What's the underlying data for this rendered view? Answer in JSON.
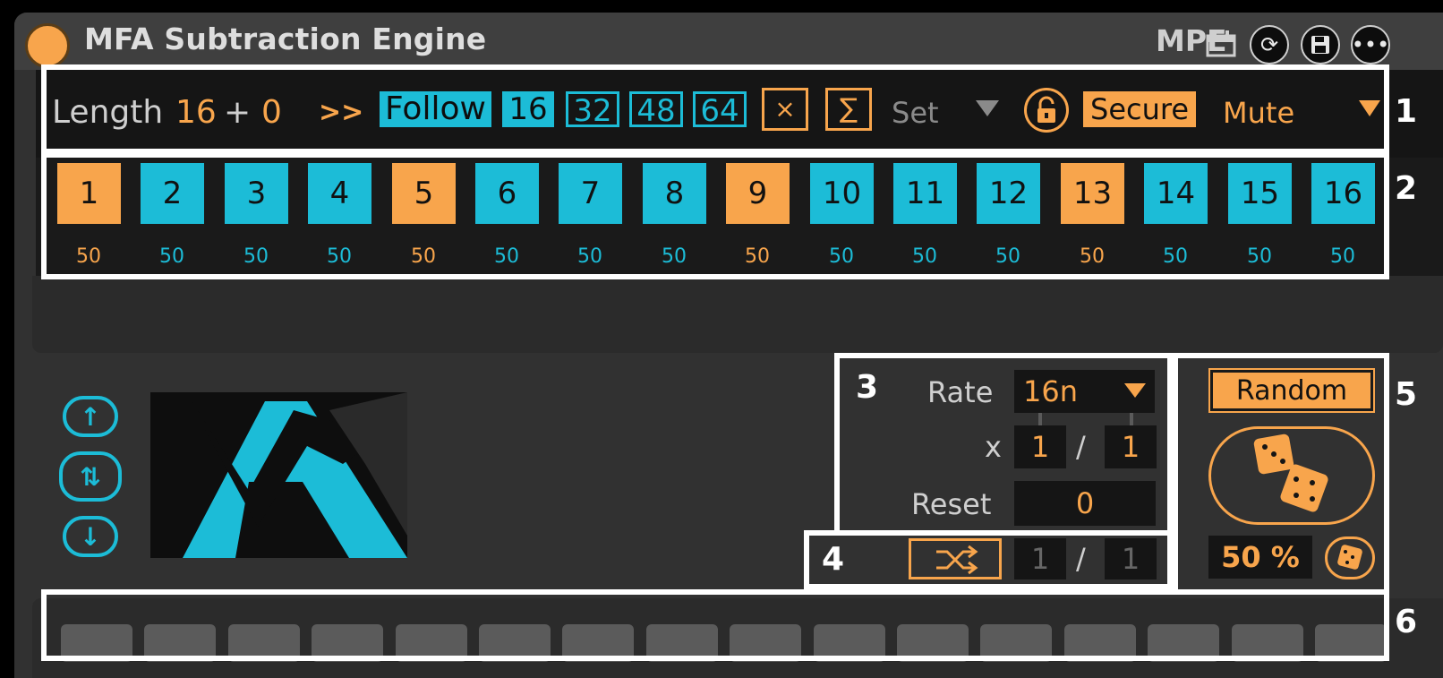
{
  "window": {
    "title": "MFA Subtraction Engine",
    "mpe_label": "MPE"
  },
  "toolbar": {
    "length_label": "Length",
    "length_value": "16",
    "plus": "+",
    "offset_value": "0",
    "shift_label": ">>",
    "follow_label": "Follow",
    "length_presets": [
      "16",
      "32",
      "48",
      "64"
    ],
    "multiply_label": "×",
    "sum_label": "∑",
    "set_label": "Set",
    "secure_label": "Secure",
    "mute_label": "Mute"
  },
  "steps": [
    {
      "label": "1",
      "velocity": "50",
      "state": "orange"
    },
    {
      "label": "2",
      "velocity": "50",
      "state": "teal"
    },
    {
      "label": "3",
      "velocity": "50",
      "state": "teal"
    },
    {
      "label": "4",
      "velocity": "50",
      "state": "teal"
    },
    {
      "label": "5",
      "velocity": "50",
      "state": "orange"
    },
    {
      "label": "6",
      "velocity": "50",
      "state": "teal"
    },
    {
      "label": "7",
      "velocity": "50",
      "state": "teal"
    },
    {
      "label": "8",
      "velocity": "50",
      "state": "teal"
    },
    {
      "label": "9",
      "velocity": "50",
      "state": "orange"
    },
    {
      "label": "10",
      "velocity": "50",
      "state": "teal"
    },
    {
      "label": "11",
      "velocity": "50",
      "state": "teal"
    },
    {
      "label": "12",
      "velocity": "50",
      "state": "teal"
    },
    {
      "label": "13",
      "velocity": "50",
      "state": "orange"
    },
    {
      "label": "14",
      "velocity": "50",
      "state": "teal"
    },
    {
      "label": "15",
      "velocity": "50",
      "state": "teal"
    },
    {
      "label": "16",
      "velocity": "50",
      "state": "teal"
    }
  ],
  "rate_section": {
    "rate_label": "Rate",
    "rate_value": "16n",
    "x_label": "x",
    "numerator": "1",
    "slash": "/",
    "denominator": "1",
    "reset_label": "Reset",
    "reset_value": "0"
  },
  "shuffle_section": {
    "numerator": "1",
    "slash": "/",
    "denominator": "1"
  },
  "random_section": {
    "random_label": "Random",
    "probability": "50 %"
  },
  "markers": [
    "1",
    "2",
    "3",
    "4",
    "5",
    "6"
  ],
  "colors": {
    "accent_orange": "#f8a54c",
    "accent_teal": "#1cbcd7",
    "panel": "#313131",
    "field": "#151515"
  },
  "icons": [
    "power-orb-icon",
    "calendar-icon",
    "sync-icon",
    "save-icon",
    "more-icon",
    "lock-icon",
    "arrow-up-icon",
    "arrow-updown-icon",
    "arrow-down-icon",
    "shuffle-icon",
    "dice-icon",
    "small-dice-icon"
  ]
}
